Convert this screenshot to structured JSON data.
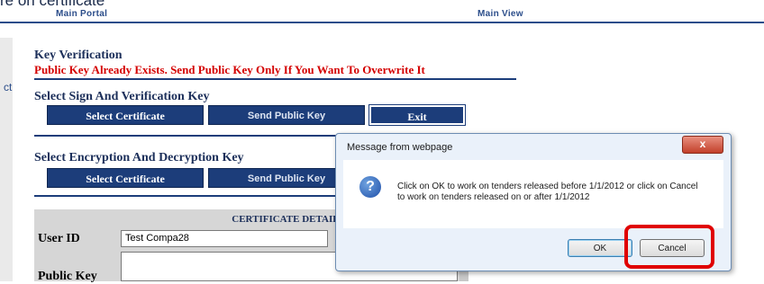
{
  "topbar": {
    "clipped_text": "re on certificate",
    "main_portal": "Main Portal",
    "main_view": "Main View"
  },
  "leftstrip": {
    "text": "ct"
  },
  "key_verification": {
    "title": "Key Verification",
    "warning": "Public Key Already Exists. Send Public Key Only If You Want To Overwrite It"
  },
  "sign_section": {
    "title": "Select Sign And Verification Key",
    "select_certificate": "Select Certificate",
    "send_public_key": "Send Public Key",
    "exit": "Exit"
  },
  "encryption_section": {
    "title": "Select Encryption And Decryption Key",
    "select_certificate": "Select Certificate",
    "send_public_key": "Send Public Key"
  },
  "certificate": {
    "header": "CERTIFICATE DETAILS",
    "user_id_label": "User ID",
    "user_id_value": "Test Compa28",
    "public_key_label": "Public Key"
  },
  "dialog": {
    "title": "Message from webpage",
    "close_glyph": "x",
    "icon_glyph": "?",
    "message": "Click on OK to work on tenders released before 1/1/2012 or click on Cancel to work on tenders released on or after 1/1/2012",
    "ok_label": "OK",
    "cancel_label": "Cancel"
  },
  "colors": {
    "accent": "#1c3d7a",
    "warning": "#d40000",
    "highlight": "#e00000"
  }
}
